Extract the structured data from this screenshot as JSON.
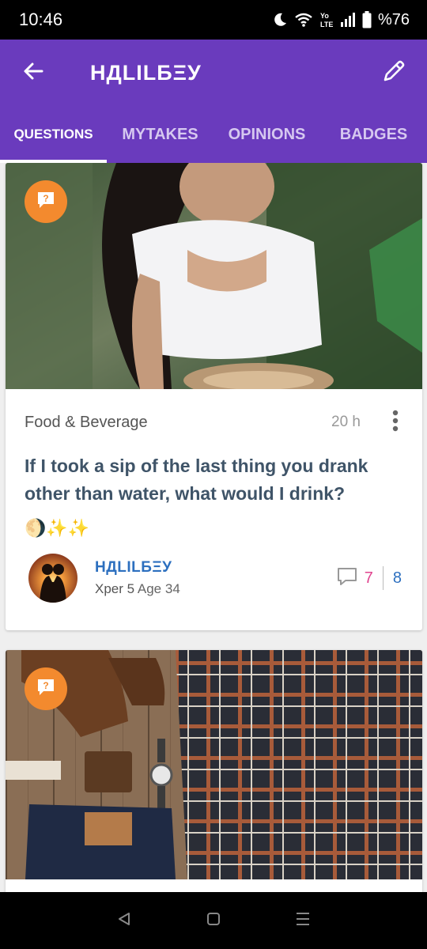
{
  "status_bar": {
    "time": "10:46",
    "lte_label": "Yo LTE",
    "battery": "%76"
  },
  "app_bar": {
    "title": "НДLILБΞУ",
    "back_icon": "arrow-left-icon",
    "edit_icon": "pencil-icon"
  },
  "tabs": [
    {
      "label": "QUESTIONS",
      "active": true
    },
    {
      "label": "MYTAKES",
      "active": false
    },
    {
      "label": "OPINIONS",
      "active": false
    },
    {
      "label": "BADGES",
      "active": false
    }
  ],
  "cards": [
    {
      "category": "Food & Beverage",
      "time_ago": "20 h",
      "title": "If I took a sip of the last thing you drank other than water, what would I drink?",
      "emoji": "🌖✨✨",
      "author": {
        "name": "НДLILБΞУ",
        "xper": "Xper 5",
        "age": "Age 34"
      },
      "stats": {
        "opinions": "7",
        "votes": "8"
      }
    }
  ],
  "colors": {
    "primary": "#6a3bbd",
    "question_badge": "#f38a2e",
    "title_text": "#3f5468",
    "author_link": "#2c6fbf",
    "opinion_count": "#e0458f"
  }
}
